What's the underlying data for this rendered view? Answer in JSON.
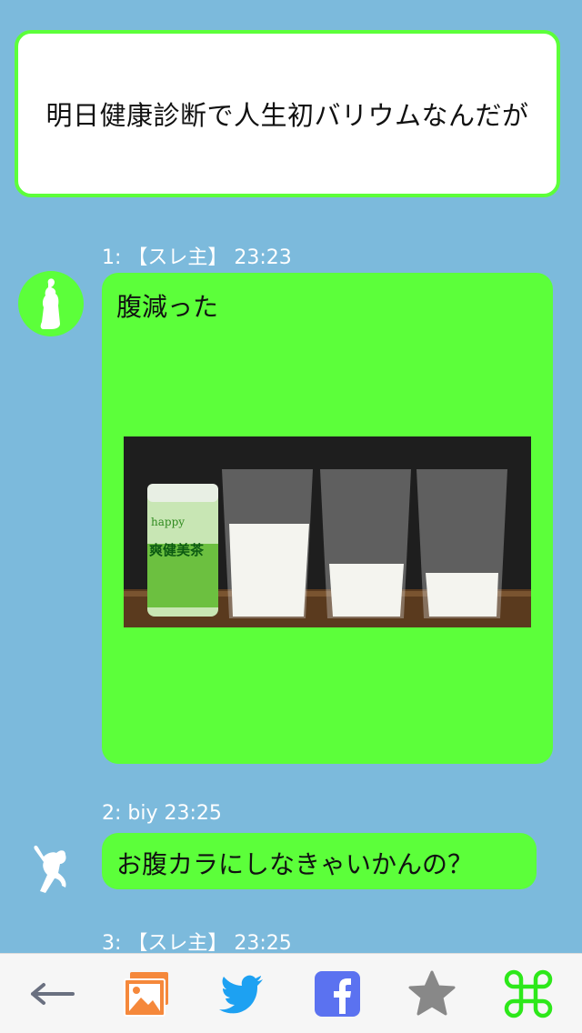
{
  "thread": {
    "title": "明日健康診断で人生初バリウムなんだが"
  },
  "posts": [
    {
      "meta": "1: 【スレ主】  23:23",
      "body": "腹減った",
      "image": {
        "can_label_top": "happy",
        "can_label_main": "爽健美茶"
      }
    },
    {
      "meta": "2: biy  23:25",
      "body": "お腹カラにしなきゃいかんの？"
    },
    {
      "meta": "3: 【スレ主】  23:25"
    }
  ],
  "toolbar": {
    "items": [
      {
        "icon": "back-arrow-icon"
      },
      {
        "icon": "image-gallery-icon"
      },
      {
        "icon": "twitter-icon"
      },
      {
        "icon": "facebook-icon"
      },
      {
        "icon": "star-icon"
      },
      {
        "icon": "command-icon"
      }
    ]
  },
  "colors": {
    "background": "#7cbadc",
    "bubble": "#5cff3a",
    "title_border": "#5cff3a",
    "twitter": "#1da1f2",
    "facebook": "#5b72f0",
    "gallery": "#f5883b",
    "star": "#888888",
    "command": "#2de81a"
  }
}
